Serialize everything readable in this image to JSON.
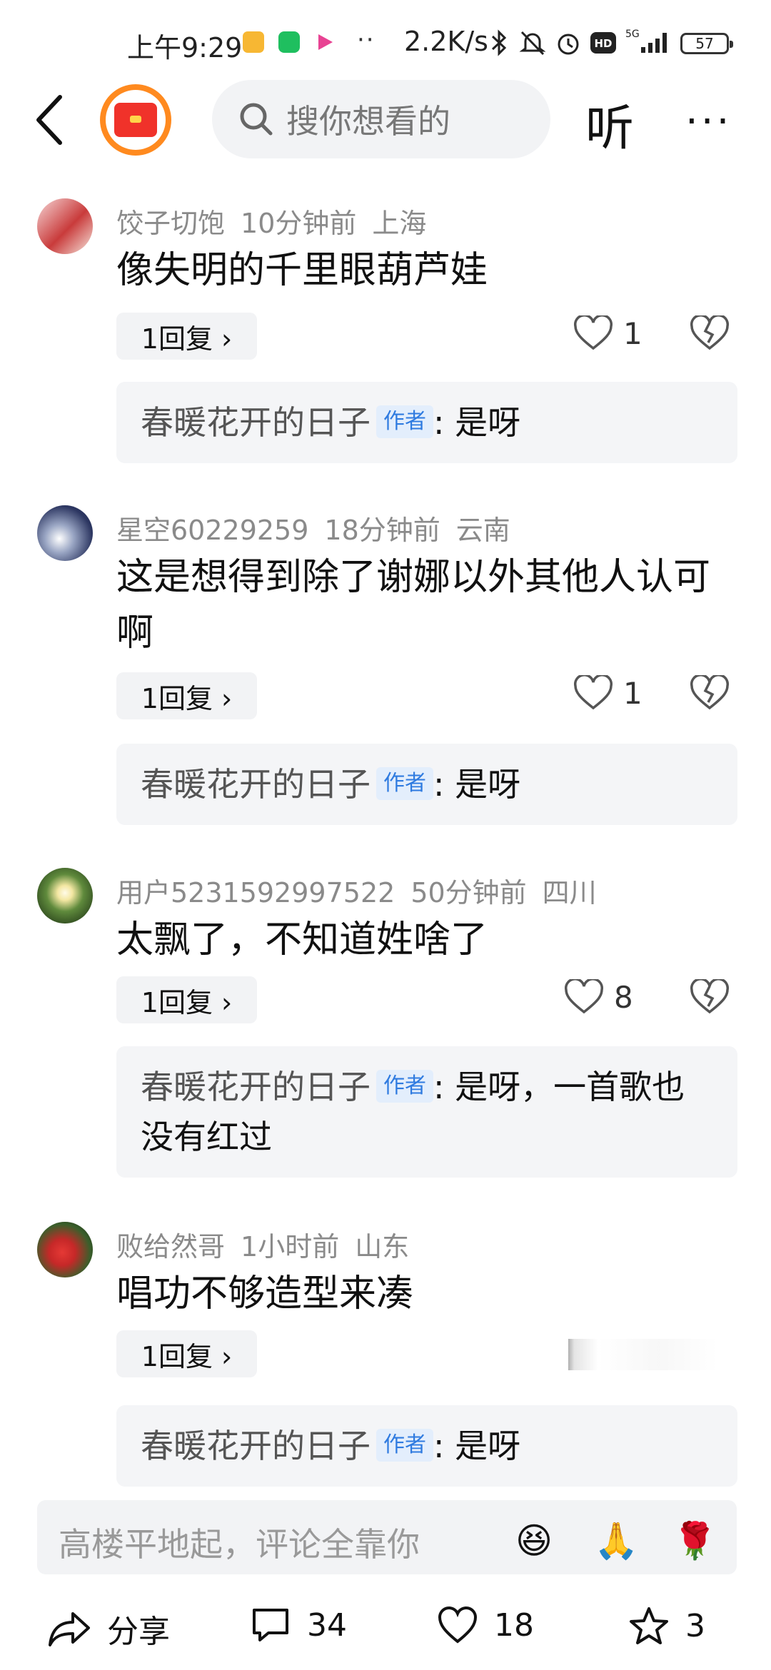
{
  "status_bar": {
    "time": "上午9:29",
    "dots": "··",
    "network_speed": "2.2K/s",
    "network_type": "5G",
    "battery": "57"
  },
  "header": {
    "search_placeholder": "搜你想看的",
    "listen_label": "听",
    "more_label": "···"
  },
  "comments": [
    {
      "username": "饺子切饱",
      "time": "10分钟前",
      "location": "上海",
      "text": "像失明的千里眼葫芦娃",
      "reply_button": "1回复 ›",
      "likes": "1",
      "author_reply": {
        "name": "春暖花开的日子",
        "tag": "作者",
        "text": ": 是呀"
      }
    },
    {
      "username": "星空60229259",
      "time": "18分钟前",
      "location": "云南",
      "text": "这是想得到除了谢娜以外其他人认可啊",
      "reply_button": "1回复 ›",
      "likes": "1",
      "author_reply": {
        "name": "春暖花开的日子",
        "tag": "作者",
        "text": ": 是呀"
      }
    },
    {
      "username": "用户5231592997522",
      "time": "50分钟前",
      "location": "四川",
      "text": "太飘了，不知道姓啥了",
      "reply_button": "1回复 ›",
      "likes": "8",
      "author_reply": {
        "name": "春暖花开的日子",
        "tag": "作者",
        "text": ": 是呀，一首歌也没有红过"
      }
    },
    {
      "username": "败给然哥",
      "time": "1小时前",
      "location": "山东",
      "text": "唱功不够造型来凑",
      "reply_button": "1回复 ›",
      "author_reply": {
        "name": "春暖花开的日子",
        "tag": "作者",
        "text": ": 是呀"
      }
    }
  ],
  "comment_input": {
    "placeholder": "高楼平地起，评论全靠你",
    "emojis": [
      "😆",
      "🙏",
      "🌹"
    ]
  },
  "bottom_bar": {
    "share_label": "分享",
    "comments_count": "34",
    "likes_count": "18",
    "favorites_count": "3"
  },
  "colors": {
    "logo_ring": "#ff8a1f",
    "logo_red": "#f0322a",
    "author_tag_bg": "#e3eefc",
    "author_tag_text": "#2f7be0"
  }
}
